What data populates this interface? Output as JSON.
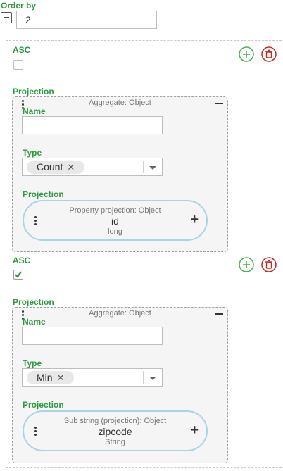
{
  "order_by": {
    "label": "Order by",
    "value": "2"
  },
  "entries": [
    {
      "asc_label": "ASC",
      "asc_checked": false,
      "projection_label": "Projection",
      "aggregate": {
        "title": "Aggregate: Object",
        "name_label": "Name",
        "name_value": "",
        "type_label": "Type",
        "type_value": "Count",
        "chip_remove": "✕",
        "projection_label": "Projection",
        "inner": {
          "title": "Property projection: Object",
          "name": "id",
          "type": "long",
          "plus": "+"
        }
      }
    },
    {
      "asc_label": "ASC",
      "asc_checked": true,
      "projection_label": "Projection",
      "aggregate": {
        "title": "Aggregate: Object",
        "name_label": "Name",
        "name_value": "",
        "type_label": "Type",
        "type_value": "Min",
        "chip_remove": "✕",
        "projection_label": "Projection",
        "inner": {
          "title": "Sub string (projection): Object",
          "name": "zipcode",
          "type": "String",
          "plus": "+"
        }
      }
    }
  ],
  "colors": {
    "label_green": "#2e9a3f",
    "add_green": "#4caf50",
    "delete_red": "#c62828",
    "pill_border": "#a8d4e4"
  },
  "icons": {
    "collapse": "minus-square-icon",
    "add": "plus-circle-icon",
    "delete": "trash-circle-icon",
    "drag": "kebab-icon",
    "caret": "caret-down-icon",
    "check": "checkmark-icon"
  }
}
